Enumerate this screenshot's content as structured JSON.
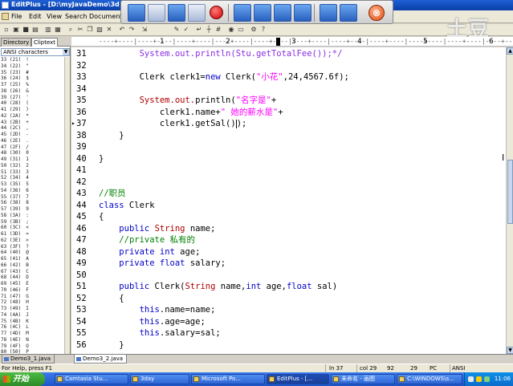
{
  "window": {
    "title": "EditPlus - [D:\\myJavaDemo\\3d",
    "min": "_",
    "max": "□",
    "close": "×"
  },
  "menu": [
    "File",
    "Edit",
    "View",
    "Search",
    "Document",
    "P"
  ],
  "ruler": {
    "marks": [
      "1",
      "2",
      "3",
      "4",
      "5",
      "6"
    ]
  },
  "left_panel": {
    "tabs": [
      "Directory",
      "Cliptext"
    ],
    "charset": "ANSI characters",
    "chars": [
      {
        "code": "33 (21)",
        "glyph": "!"
      },
      {
        "code": "34 (22)",
        "glyph": "\""
      },
      {
        "code": "35 (23)",
        "glyph": "#"
      },
      {
        "code": "36 (24)",
        "glyph": "$"
      },
      {
        "code": "37 (25)",
        "glyph": "%"
      },
      {
        "code": "38 (26)",
        "glyph": "&"
      },
      {
        "code": "39 (27)",
        "glyph": "'"
      },
      {
        "code": "40 (28)",
        "glyph": "("
      },
      {
        "code": "41 (29)",
        "glyph": ")"
      },
      {
        "code": "42 (2A)",
        "glyph": "*"
      },
      {
        "code": "43 (2B)",
        "glyph": "+"
      },
      {
        "code": "44 (2C)",
        "glyph": ","
      },
      {
        "code": "45 (2D)",
        "glyph": "-"
      },
      {
        "code": "46 (2E)",
        "glyph": "."
      },
      {
        "code": "47 (2F)",
        "glyph": "/"
      },
      {
        "code": "48 (30)",
        "glyph": "0"
      },
      {
        "code": "49 (31)",
        "glyph": "1"
      },
      {
        "code": "50 (32)",
        "glyph": "2"
      },
      {
        "code": "51 (33)",
        "glyph": "3"
      },
      {
        "code": "52 (34)",
        "glyph": "4"
      },
      {
        "code": "53 (35)",
        "glyph": "5"
      },
      {
        "code": "54 (36)",
        "glyph": "6"
      },
      {
        "code": "55 (37)",
        "glyph": "7"
      },
      {
        "code": "56 (38)",
        "glyph": "8"
      },
      {
        "code": "57 (39)",
        "glyph": "9"
      },
      {
        "code": "58 (3A)",
        "glyph": ":"
      },
      {
        "code": "59 (3B)",
        "glyph": ";"
      },
      {
        "code": "60 (3C)",
        "glyph": "<"
      },
      {
        "code": "61 (3D)",
        "glyph": "="
      },
      {
        "code": "62 (3E)",
        "glyph": ">"
      },
      {
        "code": "63 (3F)",
        "glyph": "?"
      },
      {
        "code": "64 (40)",
        "glyph": "@"
      },
      {
        "code": "65 (41)",
        "glyph": "A"
      },
      {
        "code": "66 (42)",
        "glyph": "B"
      },
      {
        "code": "67 (43)",
        "glyph": "C"
      },
      {
        "code": "68 (44)",
        "glyph": "D"
      },
      {
        "code": "69 (45)",
        "glyph": "E"
      },
      {
        "code": "70 (46)",
        "glyph": "F"
      },
      {
        "code": "71 (47)",
        "glyph": "G"
      },
      {
        "code": "72 (48)",
        "glyph": "H"
      },
      {
        "code": "73 (49)",
        "glyph": "I"
      },
      {
        "code": "74 (4A)",
        "glyph": "J"
      },
      {
        "code": "75 (4B)",
        "glyph": "K"
      },
      {
        "code": "76 (4C)",
        "glyph": "L"
      },
      {
        "code": "77 (4D)",
        "glyph": "M"
      },
      {
        "code": "78 (4E)",
        "glyph": "N"
      },
      {
        "code": "79 (4F)",
        "glyph": "O"
      },
      {
        "code": "80 (50)",
        "glyph": "P"
      }
    ]
  },
  "editor": {
    "current_line": 37,
    "lines": [
      {
        "n": "31",
        "parts": [
          [
            "        ",
            ""
          ],
          [
            "System.out.",
            "sys"
          ],
          [
            "println(Stu.getTotalFee());*/",
            "sys"
          ]
        ]
      },
      {
        "n": "32",
        "parts": []
      },
      {
        "n": "33",
        "parts": [
          [
            "        Clerk clerk1=",
            ""
          ],
          [
            "new",
            "kw"
          ],
          [
            " Clerk(",
            ""
          ],
          [
            "\"小花\"",
            "str"
          ],
          [
            ",24,4567.6f);",
            ""
          ]
        ]
      },
      {
        "n": "34",
        "parts": []
      },
      {
        "n": "35",
        "parts": [
          [
            "        ",
            ""
          ],
          [
            "System.out.",
            "ty"
          ],
          [
            "println(",
            ""
          ],
          [
            "\"名字是\"",
            "str"
          ],
          [
            "+",
            ""
          ]
        ]
      },
      {
        "n": "36",
        "parts": [
          [
            "            clerk1.name+",
            ""
          ],
          [
            "\" 她的薪水是\"",
            "str"
          ],
          [
            "+",
            ""
          ]
        ]
      },
      {
        "n": "37",
        "parts": [
          [
            "            clerk1.getSal()",
            ""
          ],
          [
            "CARET",
            "caret"
          ],
          [
            ");",
            ""
          ]
        ]
      },
      {
        "n": "38",
        "parts": [
          [
            "    }",
            ""
          ]
        ]
      },
      {
        "n": "39",
        "parts": []
      },
      {
        "n": "40",
        "parts": [
          [
            "}",
            ""
          ]
        ]
      },
      {
        "n": "41",
        "parts": []
      },
      {
        "n": "42",
        "parts": []
      },
      {
        "n": "43",
        "parts": [
          [
            "//职员",
            "cm"
          ]
        ]
      },
      {
        "n": "44",
        "parts": [
          [
            "class",
            "kw"
          ],
          [
            " Clerk",
            ""
          ]
        ]
      },
      {
        "n": "45",
        "parts": [
          [
            "{",
            ""
          ]
        ]
      },
      {
        "n": "46",
        "parts": [
          [
            "    ",
            ""
          ],
          [
            "public",
            "kw"
          ],
          [
            " ",
            ""
          ],
          [
            "String",
            "ty"
          ],
          [
            " name;",
            ""
          ]
        ]
      },
      {
        "n": "47",
        "parts": [
          [
            "    ",
            ""
          ],
          [
            "//private 私有的",
            "cm"
          ]
        ]
      },
      {
        "n": "48",
        "parts": [
          [
            "    ",
            ""
          ],
          [
            "private",
            "kw"
          ],
          [
            " ",
            ""
          ],
          [
            "int",
            "kw"
          ],
          [
            " age;",
            ""
          ]
        ]
      },
      {
        "n": "49",
        "parts": [
          [
            "    ",
            ""
          ],
          [
            "private",
            "kw"
          ],
          [
            " ",
            ""
          ],
          [
            "float",
            "kw"
          ],
          [
            " salary;",
            ""
          ]
        ]
      },
      {
        "n": "50",
        "parts": []
      },
      {
        "n": "51",
        "parts": [
          [
            "    ",
            ""
          ],
          [
            "public",
            "kw"
          ],
          [
            " Clerk(",
            ""
          ],
          [
            "String",
            "ty"
          ],
          [
            " name,",
            ""
          ],
          [
            "int",
            "kw"
          ],
          [
            " age,",
            ""
          ],
          [
            "float",
            "kw"
          ],
          [
            " sal)",
            ""
          ]
        ]
      },
      {
        "n": "52",
        "parts": [
          [
            "    {",
            ""
          ]
        ]
      },
      {
        "n": "53",
        "parts": [
          [
            "        ",
            ""
          ],
          [
            "this",
            "kw"
          ],
          [
            ".name=name;",
            ""
          ]
        ]
      },
      {
        "n": "54",
        "parts": [
          [
            "        ",
            ""
          ],
          [
            "this",
            "kw"
          ],
          [
            ".age=age;",
            ""
          ]
        ]
      },
      {
        "n": "55",
        "parts": [
          [
            "        ",
            ""
          ],
          [
            "this",
            "kw"
          ],
          [
            ".salary=sal;",
            ""
          ]
        ]
      },
      {
        "n": "56",
        "parts": [
          [
            "    }",
            ""
          ]
        ]
      }
    ]
  },
  "watermark": "土豆",
  "file_tabs": [
    {
      "label": "Demo3_1.java",
      "active": false
    },
    {
      "label": "Demo3_2.java",
      "active": true
    }
  ],
  "status": {
    "help": "For Help, press F1",
    "ln": "ln 37",
    "col": "col 29",
    "n1": "92",
    "n2": "29",
    "mode": "PC",
    "encoding": "ANSI"
  },
  "taskbar": {
    "start": "开始",
    "buttons": [
      {
        "label": "Camtasia Stu...",
        "active": false
      },
      {
        "label": "3day",
        "active": false
      },
      {
        "label": "Microsoft Po...",
        "active": false
      },
      {
        "label": "EditPlus - [...",
        "active": true
      },
      {
        "label": "未命名 - 画图",
        "active": false
      },
      {
        "label": "C:\\WINDOWS\\s...",
        "active": false
      }
    ],
    "clock": "11:06"
  }
}
